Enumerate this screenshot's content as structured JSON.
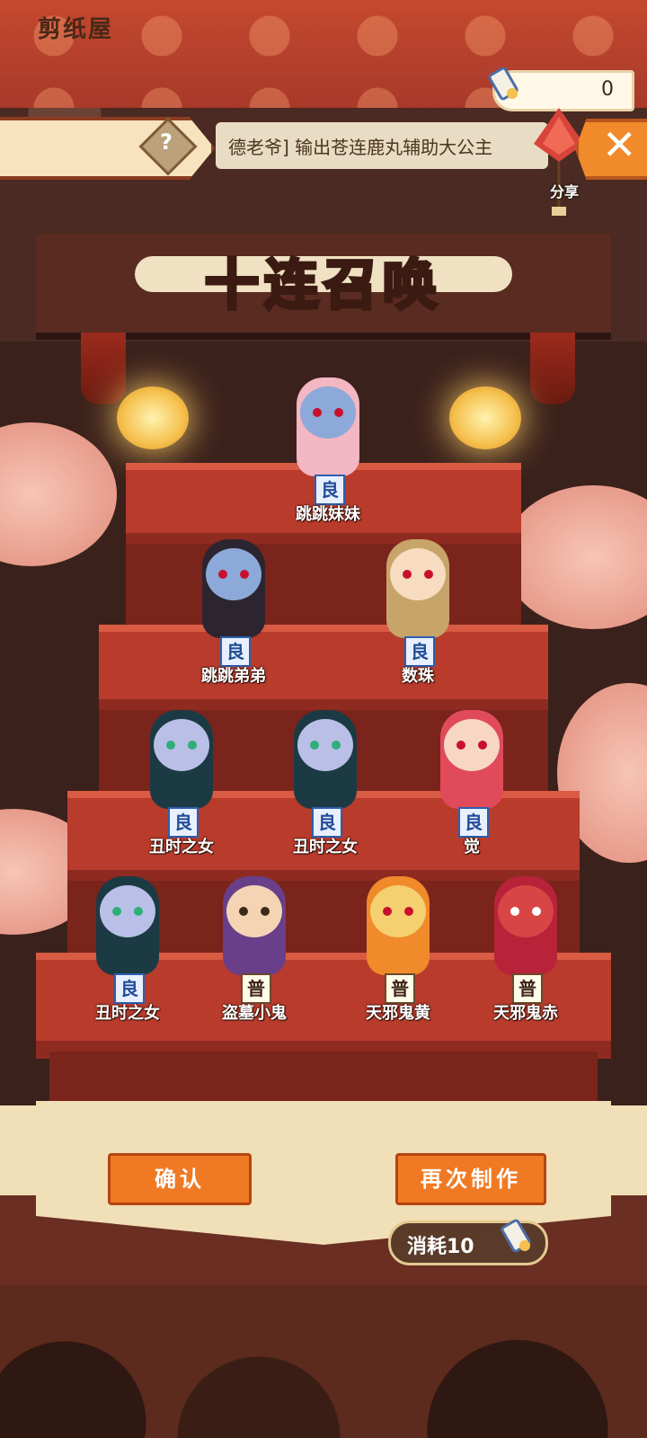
{
  "header": {
    "currency_value": "0",
    "title": "剪纸屋",
    "help_label": "?",
    "marquee": "德老爷] 输出苍连鹿丸辅助大公主",
    "share_label": "分享",
    "close_label": "✕"
  },
  "banner": {
    "title": "十连召唤"
  },
  "results": [
    {
      "name": "跳跳妹妹",
      "rank": "良",
      "body_color": "#f3b6c3",
      "head_color": "#8da9d9"
    },
    {
      "name": "跳跳弟弟",
      "rank": "良",
      "body_color": "#2c2530",
      "head_color": "#8da9d9"
    },
    {
      "name": "数珠",
      "rank": "良",
      "body_color": "#c7a56a",
      "head_color": "#f7dcc0"
    },
    {
      "name": "丑时之女",
      "rank": "良",
      "body_color": "#1c3a44",
      "head_color": "#b9bfe6"
    },
    {
      "name": "丑时之女",
      "rank": "良",
      "body_color": "#1c3a44",
      "head_color": "#b9bfe6"
    },
    {
      "name": "觉",
      "rank": "良",
      "body_color": "#e04a5b",
      "head_color": "#f7d7c4"
    },
    {
      "name": "丑时之女",
      "rank": "良",
      "body_color": "#1c3a44",
      "head_color": "#b9bfe6"
    },
    {
      "name": "盗墓小鬼",
      "rank": "普",
      "body_color": "#6a3f8a",
      "head_color": "#f5d4b4"
    },
    {
      "name": "天邪鬼黄",
      "rank": "普",
      "body_color": "#f08a2a",
      "head_color": "#f5d070"
    },
    {
      "name": "天邪鬼赤",
      "rank": "普",
      "body_color": "#b8233a",
      "head_color": "#d84545"
    }
  ],
  "buttons": {
    "confirm": "确认",
    "again": "再次制作"
  },
  "cost_label": "消耗10"
}
